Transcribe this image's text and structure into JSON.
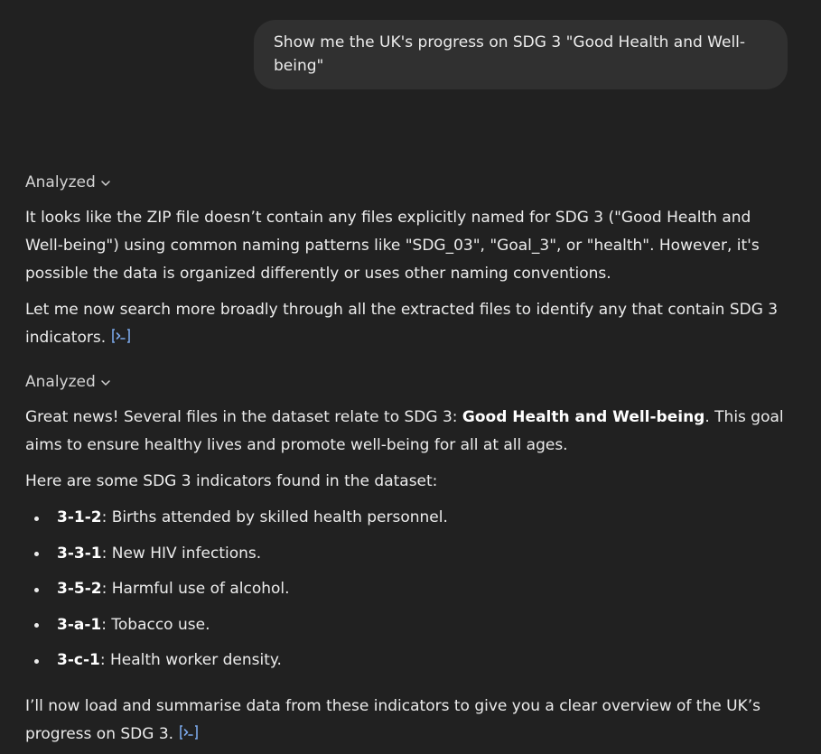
{
  "user_message": {
    "line1": "Show me the UK's progress on SDG 3 \"Good Health and Well-",
    "line2": "being\""
  },
  "assistant": {
    "analyzed_label_1": "Analyzed",
    "para1": "It looks like the ZIP file doesn’t contain any files explicitly named for SDG 3 (\"Good Health and Well-being\") using common naming patterns like \"SDG_03\", \"Goal_3\", or \"health\". However, it's possible the data is organized differently or uses other naming conventions.",
    "para2": "Let me now search more broadly through all the extracted files to identify any that contain SDG 3 indicators.",
    "analyzed_label_2": "Analyzed",
    "para3_prefix": "Great news! Several files in the dataset relate to SDG 3: ",
    "para3_bold": "Good Health and Well-being",
    "para3_suffix": ". This goal aims to ensure healthy lives and promote well-being for all at all ages.",
    "para4": "Here are some SDG 3 indicators found in the dataset:",
    "indicators": [
      {
        "code": "3-1-2",
        "desc": ": Births attended by skilled health personnel."
      },
      {
        "code": "3-3-1",
        "desc": ": New HIV infections."
      },
      {
        "code": "3-5-2",
        "desc": ": Harmful use of alcohol."
      },
      {
        "code": "3-a-1",
        "desc": ": Tobacco use."
      },
      {
        "code": "3-c-1",
        "desc": ": Health worker density."
      }
    ],
    "para5": "I’ll now load and summarise data from these indicators to give you a clear overview of the UK’s progress on SDG 3."
  },
  "colors": {
    "background": "#212121",
    "user_bubble": "#303030",
    "text": "#ececec",
    "code_icon": "#7aa7e8"
  },
  "icons": {
    "analyzed_chevron": "chevron-down-icon",
    "code_link": "code-interpreter-icon"
  }
}
